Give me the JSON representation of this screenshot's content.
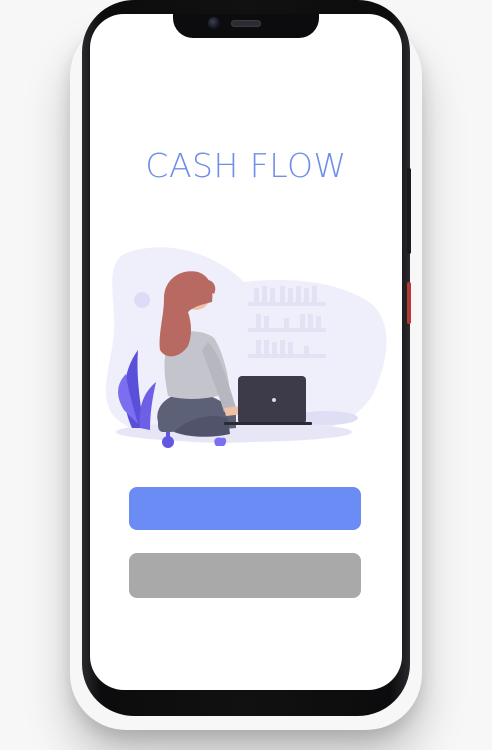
{
  "app": {
    "title": "CASH FLOW"
  },
  "buttons": {
    "primary_label": "",
    "secondary_label": ""
  },
  "colors": {
    "title": "#6f8ee8",
    "primary_button": "#6c8cf5",
    "secondary_button": "#a9a9a9",
    "illustration_bg": "#efeffb"
  },
  "icons": {
    "illustration": "woman-working-on-laptop-illustration"
  }
}
